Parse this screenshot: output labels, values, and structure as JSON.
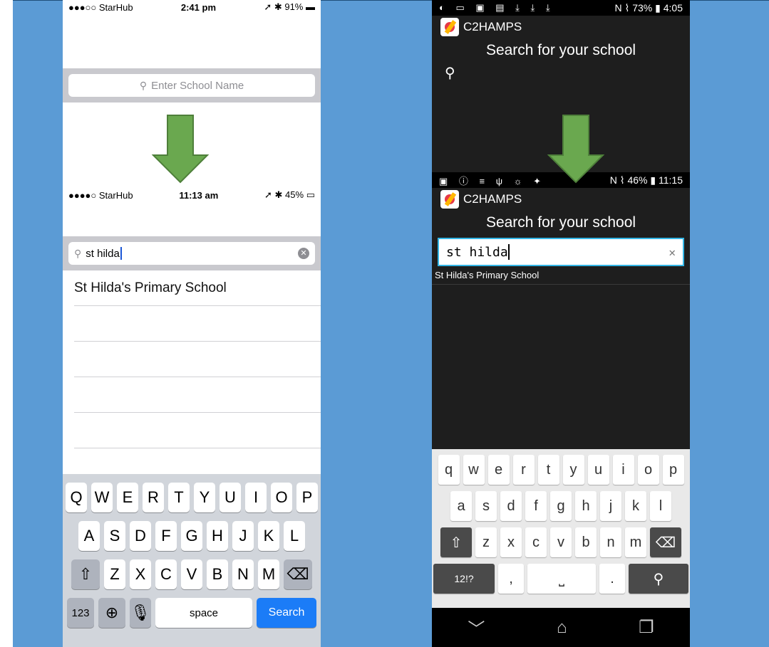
{
  "ios": {
    "before": {
      "status": {
        "carrier": "●●●○○ StarHub",
        "time": "2:41 pm",
        "battery": "91%"
      },
      "search_placeholder": "Enter School Name"
    },
    "after": {
      "status": {
        "carrier": "●●●●○ StarHub",
        "time": "11:13 am",
        "battery": "45%"
      },
      "search_value": "st hilda",
      "results": [
        "St Hilda's Primary School"
      ]
    },
    "keyboard": {
      "row1": [
        "Q",
        "W",
        "E",
        "R",
        "T",
        "Y",
        "U",
        "I",
        "O",
        "P"
      ],
      "row2": [
        "A",
        "S",
        "D",
        "F",
        "G",
        "H",
        "J",
        "K",
        "L"
      ],
      "row3": [
        "Z",
        "X",
        "C",
        "V",
        "B",
        "N",
        "M"
      ],
      "numbers_key": "123",
      "space_key": "space",
      "search_key": "Search"
    }
  },
  "android": {
    "before": {
      "status": {
        "battery": "73%",
        "time": "4:05"
      },
      "app_name": "C2HAMPS",
      "heading": "Search for your school"
    },
    "after": {
      "status": {
        "battery": "46%",
        "time": "11:15"
      },
      "app_name": "C2HAMPS",
      "heading": "Search for your school",
      "search_value": "st hilda",
      "results": [
        "St Hilda's Primary School"
      ]
    },
    "keyboard": {
      "row1": [
        "q",
        "w",
        "e",
        "r",
        "t",
        "y",
        "u",
        "i",
        "o",
        "p"
      ],
      "row2": [
        "a",
        "s",
        "d",
        "f",
        "g",
        "h",
        "j",
        "k",
        "l"
      ],
      "row3": [
        "z",
        "x",
        "c",
        "v",
        "b",
        "n",
        "m"
      ],
      "symbols_key": "12!?",
      "comma_key": ",",
      "period_key": "."
    }
  },
  "colors": {
    "background": "#5b9bd5",
    "arrow": "#6aa84f",
    "ios_search_button": "#1b7cf7",
    "android_input_border": "#33b5e5"
  }
}
